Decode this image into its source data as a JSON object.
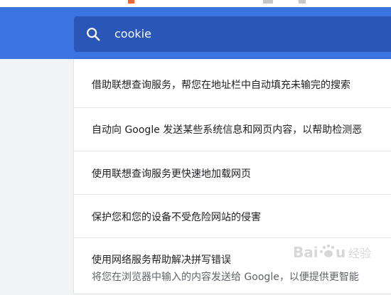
{
  "search": {
    "query": "cookie"
  },
  "settings": {
    "items": [
      {
        "title": "借助联想查询服务，帮您在地址栏中自动填充未输完的搜索"
      },
      {
        "title": "自动向 Google 发送某些系统信息和网页内容，以帮助检测恶"
      },
      {
        "title": "使用联想查询服务更快速地加载网页"
      },
      {
        "title": "保护您和您的设备不受危险网站的侵害"
      },
      {
        "title": "使用网络服务帮助解决拼写错误",
        "subtitle": "将您在浏览器中输入的内容发送给 Google，以便提供更智能"
      }
    ]
  },
  "watermark": {
    "text": "Baidu 经验"
  },
  "colors": {
    "header": "#3b74e0",
    "search_box": "#2a56b8",
    "panel": "#ffffff",
    "background": "#f1f3f4"
  }
}
